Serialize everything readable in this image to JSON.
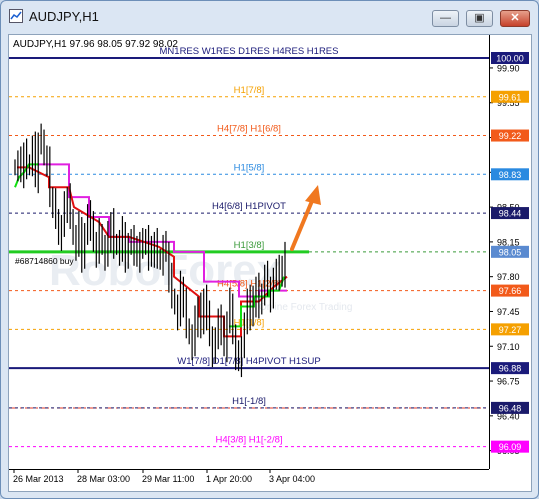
{
  "window": {
    "title": "AUDJPY,H1",
    "minimize_label": "—",
    "restore_label": "▣",
    "close_label": "✕"
  },
  "chart_header": {
    "text": "AUDJPY,H1  97.96 98.05 97.92 98.02"
  },
  "watermark": {
    "text": "RoboForex",
    "tagline": "Online Forex Trading"
  },
  "order_label": "#68714860 buy",
  "price_scale": {
    "ticks": [
      "99.90",
      "99.55",
      "99.20",
      "98.85",
      "98.50",
      "98.15",
      "97.80",
      "97.45",
      "97.10",
      "96.75",
      "96.40",
      "96.05"
    ]
  },
  "time_axis": {
    "labels": [
      "26 Mar 2013",
      "28 Mar 03:00",
      "29 Mar 11:00",
      "1 Apr 20:00",
      "3 Apr 04:00"
    ]
  },
  "levels": [
    {
      "label": "MN1RES W1RES D1RES H4RES H1RES",
      "price": "100.00",
      "color": "#1a1a7a",
      "tag_bg": "#1a1a7a",
      "tag_fg": "#ffffff"
    },
    {
      "label": "H1[7/8]",
      "price": "99.61",
      "color": "#f5a000",
      "tag_bg": "#f5a000",
      "tag_fg": "#ffffff"
    },
    {
      "label": "H4[7/8] H1[6/8]",
      "price": "99.22",
      "color": "#f25a1a",
      "tag_bg": "#f25a1a",
      "tag_fg": "#ffffff"
    },
    {
      "label": "H1[5/8]",
      "price": "98.83",
      "color": "#2a8ae0",
      "tag_bg": "#2a8ae0",
      "tag_fg": "#ffffff"
    },
    {
      "label": "H4[6/8] H1PIVOT",
      "price": "98.44",
      "color": "#1a1a6a",
      "tag_bg": "#1a1a6a",
      "tag_fg": "#ffffff"
    },
    {
      "label": "H1[3/8]",
      "price": "98.05",
      "color": "#3a9a3a",
      "tag_bg": "#5a8ad0",
      "tag_fg": "#ffffff"
    },
    {
      "label": "H4[5/8] H1[2/8]",
      "price": "97.66",
      "color": "#f25a1a",
      "tag_bg": "#f25a1a",
      "tag_fg": "#ffffff"
    },
    {
      "label": "H1[1/8]",
      "price": "97.27",
      "color": "#f5a000",
      "tag_bg": "#f5a000",
      "tag_fg": "#ffffff"
    },
    {
      "label": "W1[7/8] D1[7/8] H4PIVOT H1SUP",
      "price": "96.88",
      "color": "#1a1a7a",
      "tag_bg": "#1a1a7a",
      "tag_fg": "#ffffff"
    },
    {
      "label": "",
      "price": "",
      "color": "#e03a2a",
      "tag_bg": "",
      "tag_fg": ""
    },
    {
      "label": "H1[-1/8]",
      "price": "96.48",
      "color": "#1a1a6a",
      "tag_bg": "#1a1a6a",
      "tag_fg": "#ffffff"
    },
    {
      "label": "H4[3/8] H1[-2/8]",
      "price": "96.09",
      "color": "#ff00ff",
      "tag_bg": "#ff00ff",
      "tag_fg": "#ffffff"
    }
  ],
  "colors": {
    "candles": "#000000",
    "red_line": "#e01010",
    "magenta_line": "#e020e0",
    "green_line": "#10e010",
    "order_line": "#40c040",
    "forecast_arrow": "#f07820"
  }
}
